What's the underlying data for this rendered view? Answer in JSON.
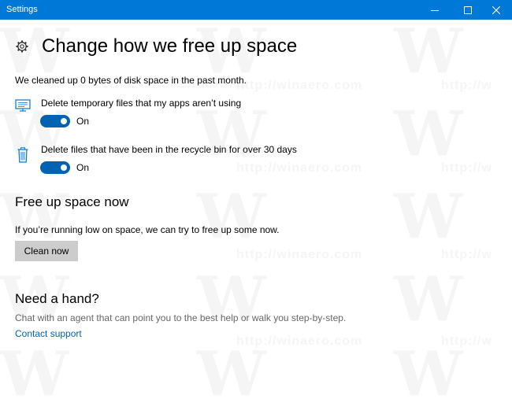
{
  "window": {
    "title": "Settings"
  },
  "header": {
    "title": "Change how we free up space",
    "icon": "gear-icon"
  },
  "summary": {
    "text": "We cleaned up 0 bytes of disk space in the past month."
  },
  "options": [
    {
      "label": "Delete temporary files that my apps aren’t using",
      "state": "On",
      "on": true,
      "icon": "monitor-icon"
    },
    {
      "label": "Delete files that have been in the recycle bin for over 30 days",
      "state": "On",
      "on": true,
      "icon": "recycle-bin-icon"
    }
  ],
  "free_up": {
    "title": "Free up space now",
    "description": "If you’re running low on space, we can try to free up some now.",
    "button_label": "Clean now"
  },
  "help": {
    "title": "Need a hand?",
    "description": "Chat with an agent that can point you to the best help or walk you step-by-step.",
    "link_label": "Contact support"
  },
  "colors": {
    "titlebar": "#0078d7",
    "accent": "#0063b1",
    "button": "#cccccc"
  }
}
